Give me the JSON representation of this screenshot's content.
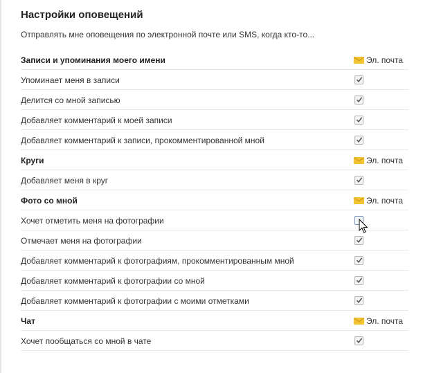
{
  "page": {
    "title": "Настройки оповещений",
    "description": "Отправлять мне оповещения по электронной почте или SMS, когда кто-то..."
  },
  "icons": {
    "column_icon": "mail-icon",
    "check_icon": "checkmark-icon",
    "cursor_icon": "mouse-pointer-icon"
  },
  "colors": {
    "mail_icon": "#f2c230",
    "checkbox_border": "#b4b4b4",
    "checkbox_hover_border": "#6f8fb7",
    "divider": "#e8e8e8"
  },
  "sections": [
    {
      "title": "Записи и упоминания моего имени",
      "column": "Эл. почта",
      "items": [
        {
          "label": "Упоминает меня в записи",
          "checked": true
        },
        {
          "label": "Делится со мной записью",
          "checked": true
        },
        {
          "label": "Добавляет комментарий к моей записи",
          "checked": true
        },
        {
          "label": "Добавляет комментарий к записи, прокомментированной мной",
          "checked": true
        }
      ]
    },
    {
      "title": "Круги",
      "column": "Эл. почта",
      "items": [
        {
          "label": "Добавляет меня в круг",
          "checked": true
        }
      ]
    },
    {
      "title": "Фото со мной",
      "column": "Эл. почта",
      "items": [
        {
          "label": "Хочет отметить меня на фотографии",
          "checked": false
        },
        {
          "label": "Отмечает меня на фотографии",
          "checked": true
        },
        {
          "label": "Добавляет комментарий к фотографиям, прокомментированным мной",
          "checked": true
        },
        {
          "label": "Добавляет комментарий к фотографии со мной",
          "checked": true
        },
        {
          "label": "Добавляет комментарий к фотографии с моими отметками",
          "checked": true
        }
      ]
    },
    {
      "title": "Чат",
      "column": "Эл. почта",
      "items": [
        {
          "label": "Хочет пообщаться со мной в чате",
          "checked": true
        }
      ]
    }
  ]
}
